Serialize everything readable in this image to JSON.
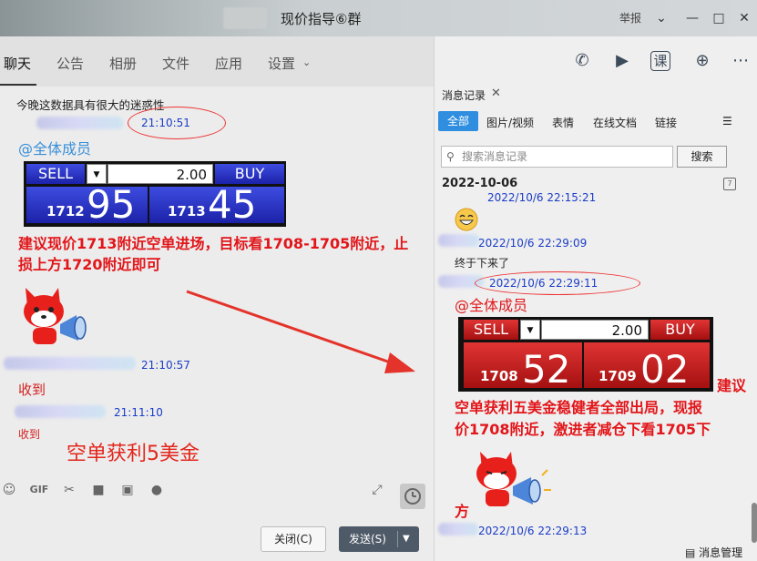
{
  "window": {
    "title": "现价指导⑥群",
    "report_label": "举报"
  },
  "tabs": [
    "聊天",
    "公告",
    "相册",
    "文件",
    "应用",
    "设置"
  ],
  "chat": {
    "msg1_text": "今晚这数据具有很大的迷惑性",
    "msg1_time": "21:10:51",
    "mention": "@全体成员",
    "trade": {
      "sell": "SELL",
      "buy": "BUY",
      "qty": "2.00",
      "sell_small": "1712",
      "sell_big": "95",
      "buy_small": "1713",
      "buy_big": "45"
    },
    "advice": "建议现价1713附近空单进场，目标看1708-1705附近，止损上方1720附近即可",
    "msg3_time": "21:10:57",
    "msg3_text": "收到",
    "msg4_time": "21:11:10",
    "msg4_text": "收到",
    "draft_text": "空单获利5美金"
  },
  "buttons": {
    "close": "关闭(C)",
    "send": "发送(S)"
  },
  "history": {
    "panel_title": "消息记录",
    "filters": [
      "全部",
      "图片/视频",
      "表情",
      "在线文档",
      "链接"
    ],
    "search_placeholder": "搜索消息记录",
    "search_button": "搜索",
    "date": "2022-10-06",
    "t1": "2022/10/6 22:15:21",
    "t2": "2022/10/6 22:29:09",
    "msg2_text": "终于下来了",
    "t3": "2022/10/6 22:29:11",
    "mention": "@全体成员",
    "trade": {
      "sell": "SELL",
      "buy": "BUY",
      "qty": "2.00",
      "sell_small": "1708",
      "sell_big": "52",
      "buy_small": "1709",
      "buy_big": "02"
    },
    "advice_line1": "建议",
    "advice_line2": "空单获利五美金稳健者全部出局，现报",
    "advice_line3": "价1708附近，激进者减仓下看1705下",
    "advice_line4": "方",
    "t4": "2022/10/6 22:29:13",
    "manage_label": "消息管理"
  }
}
